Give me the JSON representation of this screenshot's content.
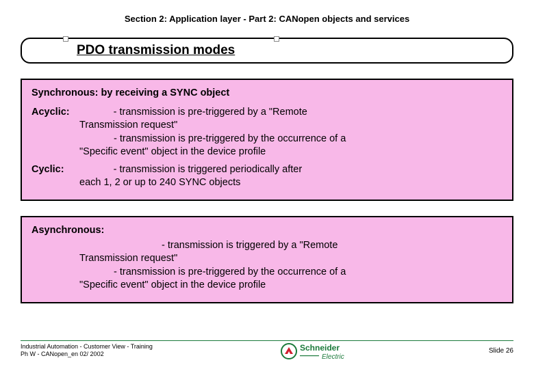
{
  "header": "Section 2: Application layer - Part 2: CANopen objects and services",
  "title": "PDO transmission modes",
  "box1": {
    "heading": "Synchronous: by receiving a SYNC object",
    "acyclic_label": "Acyclic:",
    "acyclic_line1a": "- transmission is pre-triggered by a \"Remote",
    "acyclic_line1b": "Transmission request\"",
    "acyclic_line2a": "- transmission is pre-triggered by the occurrence of a",
    "acyclic_line2b": "\"Specific event\" object in the device profile",
    "cyclic_label": "Cyclic:",
    "cyclic_line1a": "- transmission is triggered periodically after",
    "cyclic_line1b": "each 1, 2 or up to 240 SYNC objects"
  },
  "box2": {
    "heading": "Asynchronous:",
    "line1a": "- transmission is triggered by a \"Remote",
    "line1b": "Transmission request\"",
    "line2a": "- transmission is pre-triggered by the occurrence of a",
    "line2b": "\"Specific event\" object in the device profile"
  },
  "footer": {
    "line1": "Industrial Automation - Customer View - Training",
    "line2": "Ph W - CANopen_en  02/ 2002",
    "logo_text": "Schneider",
    "logo_sub": "Electric",
    "slide": "Slide 26"
  }
}
